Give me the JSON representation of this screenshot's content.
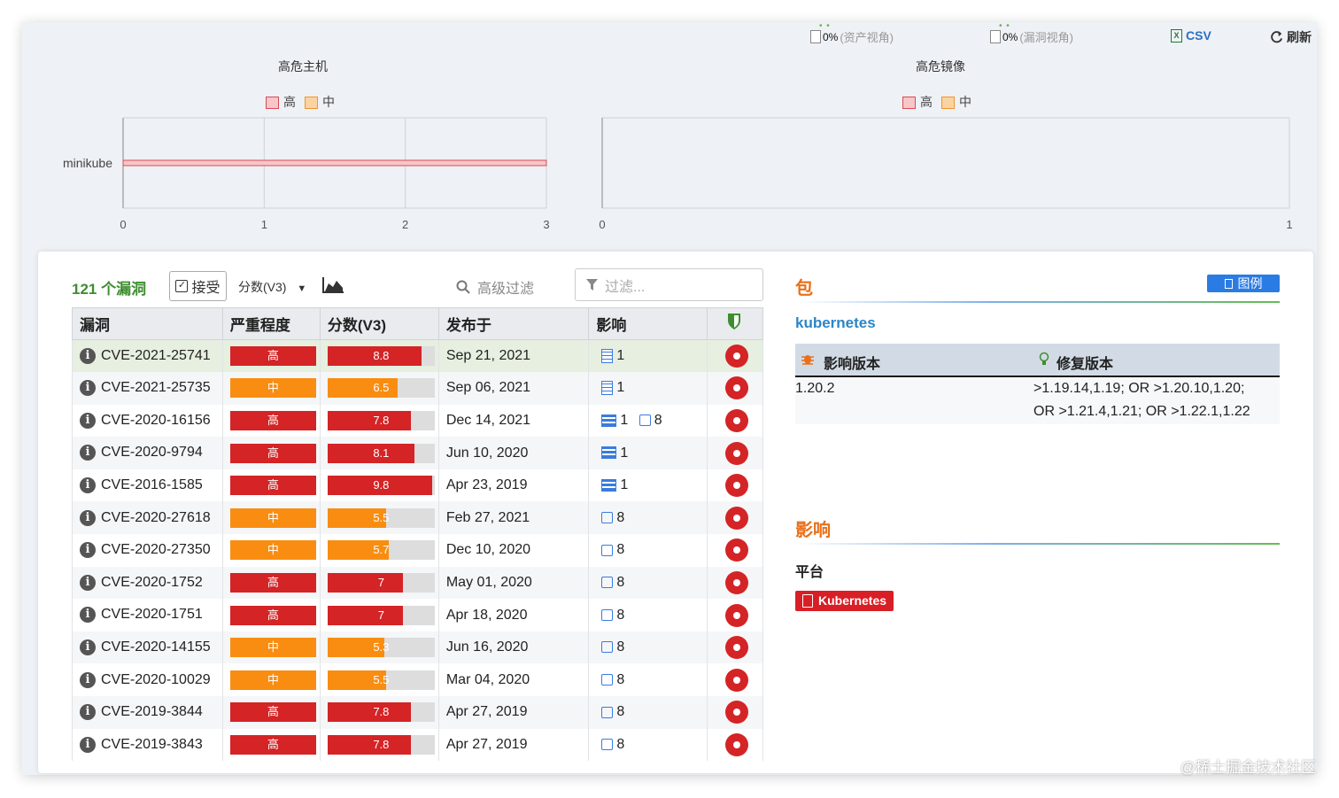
{
  "toolbar": {
    "pdf1": {
      "pct": "0%",
      "label": "(资产视角)"
    },
    "pdf2": {
      "pct": "0%",
      "label": "(漏洞视角)"
    },
    "csv_label": "CSV",
    "csv_icon": "X",
    "refresh_label": "刷新"
  },
  "charts": {
    "hosts": {
      "title": "高危主机",
      "legend": [
        "高",
        "中"
      ]
    },
    "images": {
      "title": "高危镜像",
      "legend": [
        "高",
        "中"
      ]
    }
  },
  "chart_data": [
    {
      "type": "bar",
      "orientation": "horizontal",
      "title": "高危主机",
      "categories": [
        "minikube"
      ],
      "series": [
        {
          "name": "高",
          "values": [
            3
          ]
        },
        {
          "name": "中",
          "values": [
            0
          ]
        }
      ],
      "xlim": [
        0,
        3
      ],
      "xticks": [
        "0",
        "1",
        "2",
        "3"
      ],
      "grid": true,
      "legend": "top-center",
      "colors": {
        "high": "#d94b55",
        "mid": "#f2952b"
      }
    },
    {
      "type": "bar",
      "orientation": "horizontal",
      "title": "高危镜像",
      "categories": [],
      "series": [
        {
          "name": "高",
          "values": []
        },
        {
          "name": "中",
          "values": []
        }
      ],
      "xlim": [
        0,
        1
      ],
      "xticks": [
        "0",
        "1"
      ],
      "grid": true,
      "legend": "top-center"
    }
  ],
  "vulns": {
    "count_label": "121 个漏洞",
    "accept_label": "接受",
    "accept_check": "✓",
    "score_dropdown": "分数(V3)",
    "adv_filter_label": "高级过滤",
    "filter_placeholder": "过滤...",
    "columns": [
      "漏洞",
      "严重程度",
      "分数(V3)",
      "发布于",
      "影响"
    ],
    "rows": [
      {
        "cve": "CVE-2021-25741",
        "sev": "高",
        "level": "high",
        "score": 8.8,
        "score_label": "8.8",
        "date": "Sep 21, 2021",
        "impact_icon": "building-icon",
        "impact": "1",
        "impact2": ""
      },
      {
        "cve": "CVE-2021-25735",
        "sev": "中",
        "level": "mid",
        "score": 6.5,
        "score_label": "6.5",
        "date": "Sep 06, 2021",
        "impact_icon": "building-icon",
        "impact": "1",
        "impact2": ""
      },
      {
        "cve": "CVE-2020-16156",
        "sev": "高",
        "level": "high",
        "score": 7.8,
        "score_label": "7.8",
        "date": "Dec 14, 2021",
        "impact_icon": "server-icon",
        "impact": "1",
        "impact2": "8"
      },
      {
        "cve": "CVE-2020-9794",
        "sev": "高",
        "level": "high",
        "score": 8.1,
        "score_label": "8.1",
        "date": "Jun 10, 2020",
        "impact_icon": "server-icon",
        "impact": "1",
        "impact2": ""
      },
      {
        "cve": "CVE-2016-1585",
        "sev": "高",
        "level": "high",
        "score": 9.8,
        "score_label": "9.8",
        "date": "Apr 23, 2019",
        "impact_icon": "server-icon",
        "impact": "1",
        "impact2": ""
      },
      {
        "cve": "CVE-2020-27618",
        "sev": "中",
        "level": "mid",
        "score": 5.5,
        "score_label": "5.5",
        "date": "Feb 27, 2021",
        "impact_icon": "box-icon",
        "impact": "8",
        "impact2": ""
      },
      {
        "cve": "CVE-2020-27350",
        "sev": "中",
        "level": "mid",
        "score": 5.7,
        "score_label": "5.7",
        "date": "Dec 10, 2020",
        "impact_icon": "box-icon",
        "impact": "8",
        "impact2": ""
      },
      {
        "cve": "CVE-2020-1752",
        "sev": "高",
        "level": "high",
        "score": 7,
        "score_label": "7",
        "date": "May 01, 2020",
        "impact_icon": "box-icon",
        "impact": "8",
        "impact2": ""
      },
      {
        "cve": "CVE-2020-1751",
        "sev": "高",
        "level": "high",
        "score": 7,
        "score_label": "7",
        "date": "Apr 18, 2020",
        "impact_icon": "box-icon",
        "impact": "8",
        "impact2": ""
      },
      {
        "cve": "CVE-2020-14155",
        "sev": "中",
        "level": "mid",
        "score": 5.3,
        "score_label": "5.3",
        "date": "Jun 16, 2020",
        "impact_icon": "box-icon",
        "impact": "8",
        "impact2": ""
      },
      {
        "cve": "CVE-2020-10029",
        "sev": "中",
        "level": "mid",
        "score": 5.5,
        "score_label": "5.5",
        "date": "Mar 04, 2020",
        "impact_icon": "box-icon",
        "impact": "8",
        "impact2": ""
      },
      {
        "cve": "CVE-2019-3844",
        "sev": "高",
        "level": "high",
        "score": 7.8,
        "score_label": "7.8",
        "date": "Apr 27, 2019",
        "impact_icon": "box-icon",
        "impact": "8",
        "impact2": ""
      },
      {
        "cve": "CVE-2019-3843",
        "sev": "高",
        "level": "high",
        "score": 7.8,
        "score_label": "7.8",
        "date": "Apr 27, 2019",
        "impact_icon": "box-icon",
        "impact": "8",
        "impact2": ""
      }
    ],
    "score_max": 10
  },
  "package": {
    "section_title": "包",
    "legend_label": "图例",
    "name": "kubernetes",
    "col_affected": "影响版本",
    "col_fixed": "修复版本",
    "affected": "1.20.2",
    "fixed_line1": ">1.19.14,1.19; OR >1.20.10,1.20;",
    "fixed_line2": "OR >1.21.4,1.21; OR >1.22.1,1.22"
  },
  "impact": {
    "section_title": "影响",
    "platform_label": "平台",
    "platform_badge": "Kubernetes"
  },
  "watermark": "@稀土掘金技术社区",
  "colors": {
    "high": "#d42426",
    "mid": "#f98d11",
    "accent": "#2b7be4",
    "count": "#3e8e2f"
  }
}
